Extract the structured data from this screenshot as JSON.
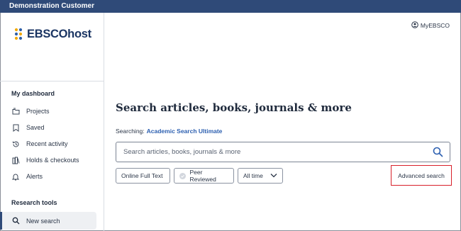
{
  "top_bar": {
    "title": "Demonstration Customer"
  },
  "logo": {
    "text": "EBSCOhost"
  },
  "sidebar": {
    "dashboard_title": "My dashboard",
    "dashboard_items": [
      {
        "label": "Projects",
        "icon": "folder-icon"
      },
      {
        "label": "Saved",
        "icon": "bookmark-icon"
      },
      {
        "label": "Recent activity",
        "icon": "history-icon"
      },
      {
        "label": "Holds & checkouts",
        "icon": "books-icon"
      },
      {
        "label": "Alerts",
        "icon": "bell-icon"
      }
    ],
    "tools_title": "Research tools",
    "tools_items": [
      {
        "label": "New search",
        "icon": "search-icon",
        "active": true
      }
    ]
  },
  "header": {
    "account_label": "MyEBSCO",
    "account_icon": "user-circle-icon"
  },
  "main": {
    "headline": "Search articles, books, journals & more",
    "searching_label": "Searching:",
    "database": "Academic Search Ultimate",
    "search_placeholder": "Search articles, books, journals & more",
    "filters": {
      "full_text": "Online Full Text",
      "peer_reviewed": "Peer Reviewed",
      "time": "All time"
    },
    "advanced_search": "Advanced search"
  },
  "colors": {
    "top_bar": "#2f4a78",
    "link": "#2c5fb0",
    "highlight_border": "#d8202a",
    "active_bg": "#eef0f3"
  }
}
